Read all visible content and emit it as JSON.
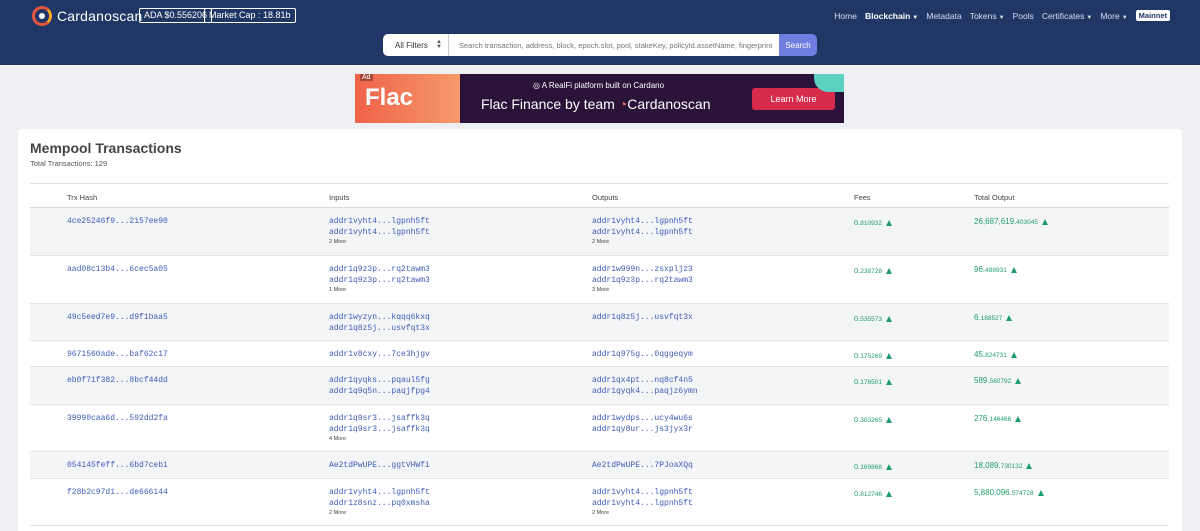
{
  "header": {
    "brand": "Cardanoscan",
    "ada_price": "ADA $0.556206",
    "market_cap": "Market Cap : 18.81b",
    "nav": [
      {
        "label": "Home"
      },
      {
        "label": "Blockchain",
        "active": true
      },
      {
        "label": "Metadata"
      },
      {
        "label": "Tokens"
      },
      {
        "label": "Pools"
      },
      {
        "label": "Certificates"
      },
      {
        "label": "More"
      }
    ],
    "network": "Mainnet"
  },
  "search": {
    "filter": "All Filters",
    "placeholder": "Search transaction, address, block, epoch.slot, pool, stakeKey, policyId.assetName, fingerprint",
    "button": "Search"
  },
  "ad": {
    "tag": "Ad",
    "brand": "Flac",
    "top_line": "A RealFi platform built on Cardano",
    "main_line": "Flac Finance by team",
    "main_brand": "Cardanoscan",
    "cta": "Learn More"
  },
  "page": {
    "title": "Mempool Transactions",
    "total_label": "Total Transactions: 129"
  },
  "table": {
    "columns": [
      "Trx Hash",
      "Inputs",
      "Outputs",
      "Fees",
      "Total Output"
    ],
    "rows": [
      {
        "hash": "4ce25246f9...2157ee90",
        "inputs": [
          "addr1vyht4...lgpnh5ft",
          "addr1vyht4...lgpnh5ft"
        ],
        "inputs_more": "2 More",
        "outputs": [
          "addr1vyht4...lgpnh5ft",
          "addr1vyht4...lgpnh5ft"
        ],
        "outputs_more": "2 More",
        "fee_int": "0.",
        "fee_dec": "810932",
        "total_int": "26,687,619.",
        "total_dec": "403045"
      },
      {
        "hash": "aad08c13b4...6cec5a05",
        "inputs": [
          "addr1q9z3p...rq2tawm3",
          "addr1q9z3p...rq2tawm3"
        ],
        "inputs_more": "1 More",
        "outputs": [
          "addr1w999n...zsxpljz3",
          "addr1q9z3p...rq2tawm3"
        ],
        "outputs_more": "3 More",
        "fee_int": "0.",
        "fee_dec": "238728",
        "total_int": "96.",
        "total_dec": "488931"
      },
      {
        "hash": "49c5eed7e9...d9f1baa5",
        "inputs": [
          "addr1wyzyn...kqqq6kxq",
          "addr1q8z5j...usvfqt3x"
        ],
        "inputs_more": "",
        "outputs": [
          "addr1q8z5j...usvfqt3x"
        ],
        "outputs_more": "",
        "fee_int": "0.",
        "fee_dec": "535573",
        "total_int": "6.",
        "total_dec": "188527"
      },
      {
        "hash": "9671560ade...baf62c17",
        "inputs": [
          "addr1v8cxy...7ce3hjgv"
        ],
        "inputs_more": "",
        "outputs": [
          "addr1q975g...0qggeqym"
        ],
        "outputs_more": "",
        "fee_int": "0.",
        "fee_dec": "175269",
        "total_int": "45.",
        "total_dec": "824731"
      },
      {
        "hash": "eb0f71f382...8bcf44dd",
        "inputs": [
          "addr1qyqks...pqaul5fg",
          "addr1q9q5n...paqjfpg4"
        ],
        "inputs_more": "",
        "outputs": [
          "addr1qx4pt...nq8cf4n5",
          "addr1qyqk4...paqjz6ymn"
        ],
        "outputs_more": "",
        "fee_int": "0.",
        "fee_dec": "176501",
        "total_int": "589.",
        "total_dec": "560792"
      },
      {
        "hash": "39990caa6d...592dd2fa",
        "inputs": [
          "addr1q9sr3...jsaffk3q",
          "addr1q9sr3...jsaffk3q"
        ],
        "inputs_more": "4 More",
        "outputs": [
          "addr1wydps...ucy4wu6s",
          "addr1qy8ur...js3jyx3r"
        ],
        "outputs_more": "",
        "fee_int": "0.",
        "fee_dec": "303265",
        "total_int": "276.",
        "total_dec": "146466"
      },
      {
        "hash": "054145feff...6bd7ceb1",
        "inputs": [
          "Ae2tdPwUPE...ggtVHWfi"
        ],
        "inputs_more": "",
        "outputs": [
          "Ae2tdPwUPE...7PJoaXQq"
        ],
        "outputs_more": "",
        "fee_int": "0.",
        "fee_dec": "169868",
        "total_int": "18,089.",
        "total_dec": "730132"
      },
      {
        "hash": "f28b2c97d1...de666144",
        "inputs": [
          "addr1vyht4...lgpnh5ft",
          "addr1z8snz...pq0xmsha"
        ],
        "inputs_more": "2 More",
        "outputs": [
          "addr1vyht4...lgpnh5ft",
          "addr1vyht4...lgpnh5ft"
        ],
        "outputs_more": "2 More",
        "fee_int": "0.",
        "fee_dec": "812746",
        "total_int": "5,880,096.",
        "total_dec": "574728"
      }
    ]
  },
  "colors": {
    "header_bg": "#203765",
    "link": "#3d5bb8",
    "positive": "#1f9d6a",
    "search_button": "#6f7ee0"
  }
}
